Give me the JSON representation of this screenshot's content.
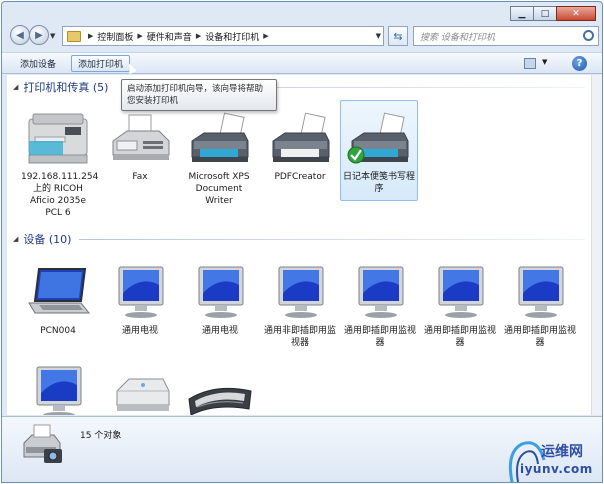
{
  "caption": {
    "minimize": "▁",
    "maximize": "□",
    "close": "✕"
  },
  "breadcrumb": [
    "控制面板",
    "硬件和声音",
    "设备和打印机"
  ],
  "search": {
    "placeholder": "搜索 设备和打印机"
  },
  "toolbar": {
    "add_device": "添加设备",
    "add_printer": "添加打印机",
    "help": "?"
  },
  "tooltip": "启动添加打印机向导，该向导将帮助您安装打印机",
  "groups": {
    "printers": {
      "title": "打印机和传真 (5)",
      "items": [
        {
          "label": "192.168.111.254 上的 RICOH Aficio 2035e PCL 6"
        },
        {
          "label": "Fax"
        },
        {
          "label": "Microsoft XPS Document Writer"
        },
        {
          "label": "PDFCreator"
        },
        {
          "label": "日记本便笺书写程序",
          "default": true
        }
      ]
    },
    "devices": {
      "title": "设备 (10)",
      "items": [
        {
          "label": "PCN004"
        },
        {
          "label": "通用电视"
        },
        {
          "label": "通用电视"
        },
        {
          "label": "通用非即插即用监视器"
        },
        {
          "label": "通用即插即用监视器"
        },
        {
          "label": "通用即插即用监视器"
        },
        {
          "label": "通用即插即用监视器"
        },
        {
          "label": ""
        },
        {
          "label": ""
        },
        {
          "label": ""
        }
      ]
    }
  },
  "details": {
    "count": "15 个对象"
  },
  "watermark": {
    "name": "运维网",
    "url": "iyunv.com"
  },
  "colors": {
    "group_header": "#1e3a8a",
    "selection": "#d6e9fa",
    "default_check": "#2fa43c"
  }
}
